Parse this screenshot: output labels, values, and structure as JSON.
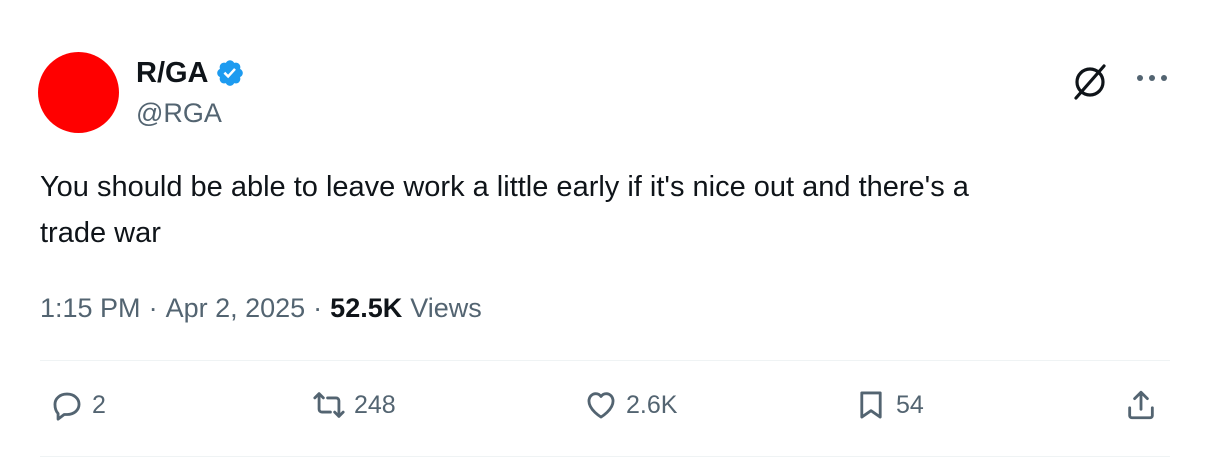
{
  "author": {
    "display_name": "R/GA",
    "handle": "@RGA",
    "verified": true,
    "avatar_color": "#ff0000",
    "verified_color": "#1d9bf0"
  },
  "tweet": {
    "text": "You should be able to leave work a little early if it's nice out and there's a\ntrade war",
    "time": "1:15 PM",
    "separator": "·",
    "date": "Apr 2, 2025",
    "views_count": "52.5K",
    "views_label": "Views"
  },
  "actions": {
    "replies": "2",
    "reposts": "248",
    "likes": "2.6K",
    "bookmarks": "54"
  },
  "icons": {
    "reply": "reply-icon",
    "repost": "repost-icon",
    "like": "heart-icon",
    "bookmark": "bookmark-icon",
    "share": "share-icon",
    "grok": "grok-icon",
    "more": "more-icon",
    "verified": "verified-badge-icon"
  },
  "colors": {
    "text_primary": "#0f1419",
    "text_secondary": "#536471",
    "divider": "#eff3f4"
  }
}
